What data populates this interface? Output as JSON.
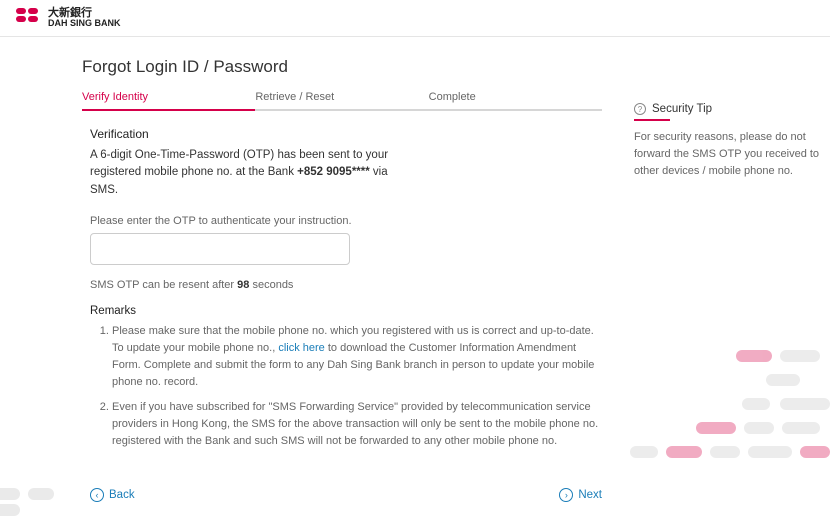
{
  "brand": {
    "cn": "大新銀行",
    "en": "DAH SING BANK"
  },
  "page_title": "Forgot Login ID / Password",
  "steps": [
    {
      "label": "Verify Identity",
      "active": true
    },
    {
      "label": "Retrieve / Reset",
      "active": false
    },
    {
      "label": "Complete",
      "active": false
    }
  ],
  "verification": {
    "heading": "Verification",
    "msg_pre": "A 6-digit One-Time-Password (OTP) has been sent to your registered mobile phone no. at the Bank ",
    "msg_bold": "+852 9095****",
    "msg_post": " via SMS.",
    "prompt": "Please enter the OTP to authenticate your instruction.",
    "input_value": "",
    "resend_pre": "SMS OTP can be resent after ",
    "resend_bold": "98",
    "resend_post": " seconds"
  },
  "remarks": {
    "heading": "Remarks",
    "items": [
      {
        "pre": "Please make sure that the mobile phone no. which you registered with us is correct and up-to-date. To update your mobile phone no., ",
        "link": "click here",
        "post": " to download the Customer Information Amendment Form. Complete and submit the form to any Dah Sing Bank branch in person to update your mobile phone no. record."
      },
      {
        "pre": "Even if you have subscribed for \"SMS Forwarding Service\" provided by telecommunication service providers in Hong Kong, the SMS for the above transaction will only be sent to the mobile phone no. registered with the Bank and such SMS will not be forwarded to any other mobile phone no.",
        "link": "",
        "post": ""
      }
    ]
  },
  "nav": {
    "back": "Back",
    "next": "Next"
  },
  "tip": {
    "title": "Security Tip",
    "text": "For security reasons, please do not forward the SMS OTP you received to other devices / mobile phone no."
  }
}
